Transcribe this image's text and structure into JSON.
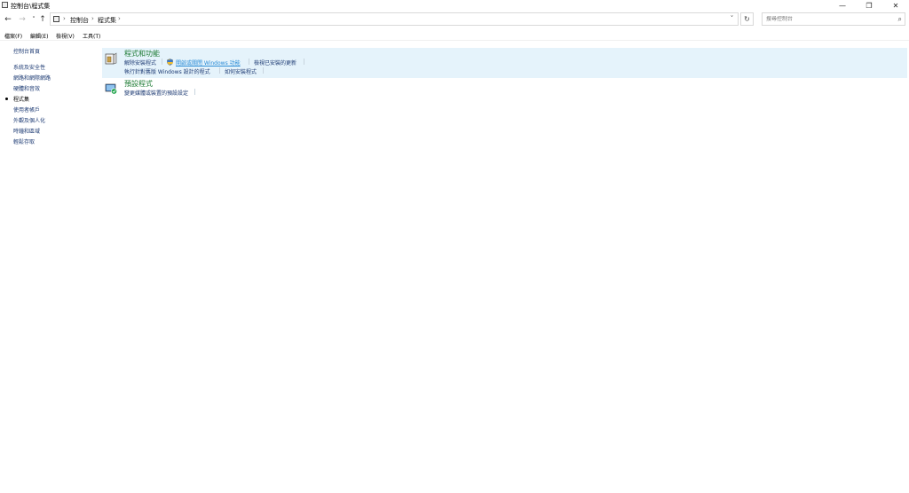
{
  "window": {
    "title": "控制台\\程式集",
    "minimize_glyph": "—",
    "restore_glyph": "❐",
    "close_glyph": "✕"
  },
  "nav": {
    "back_glyph": "←",
    "forward_glyph": "→",
    "recent_glyph": "˅",
    "up_glyph": "↑",
    "breadcrumbs": [
      "控制台",
      "程式集"
    ],
    "separator_glyph": "›",
    "dropdown_glyph": "˅",
    "refresh_glyph": "↻"
  },
  "search": {
    "placeholder": "搜尋控制台",
    "icon_glyph": "⌕"
  },
  "menu": {
    "items": [
      "檔案(F)",
      "編輯(E)",
      "檢視(V)",
      "工具(T)"
    ]
  },
  "sidebar": {
    "home": "控制台首頁",
    "items": [
      "系統及安全性",
      "網路和網際網路",
      "硬體和音效",
      "程式集",
      "使用者帳戶",
      "外觀及個人化",
      "時鐘和區域",
      "輕鬆存取"
    ],
    "current_index": 3
  },
  "categories": [
    {
      "title": "程式和功能",
      "icon": "programs-and-features-icon",
      "row1": [
        "解除安裝程式",
        "開啟或關閉 Windows 功能",
        "檢視已安裝的更新"
      ],
      "row2": [
        "執行針對舊版 Windows 設計的程式",
        "如何安裝程式"
      ]
    },
    {
      "title": "預設程式",
      "icon": "default-programs-icon",
      "row1": [
        "變更媒體或裝置的預設設定"
      ]
    }
  ],
  "colors": {
    "category_title": "#1e7b34",
    "link": "#1c3a73",
    "link_hover": "#2a8bd6",
    "panel_highlight": "#e5f3fb"
  }
}
